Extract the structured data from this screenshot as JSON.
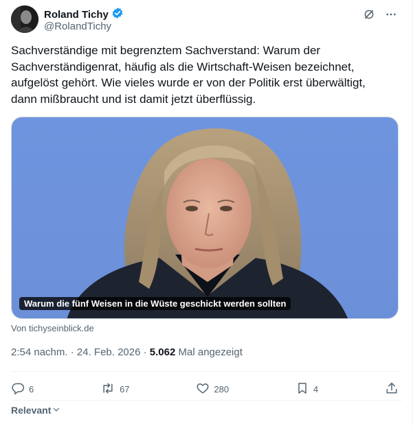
{
  "author": {
    "name": "Roland Tichy",
    "handle": "@RolandTichy",
    "verified": true
  },
  "tweet_text": "Sachverständige mit begrenztem Sachverstand: Warum der\nSachverständigenrat, häufig als die Wirtschaft-Weisen bezeichnet,\naufgelöst gehört. Wie vieles wurde er von der Politik erst überwältigt,\ndann mißbraucht und ist damit  jetzt überflüssig.",
  "link_card": {
    "caption": "Warum die fünf Weisen in die Wüste geschickt werden sollten",
    "source": "Von tichyseinblick.de"
  },
  "meta": {
    "time_date": "2:54 nachm. · 24. Feb. 2026 · ",
    "views_count": "5.062",
    "views_label": " Mal angezeigt"
  },
  "actions": {
    "replies": "6",
    "reposts": "67",
    "likes": "280",
    "bookmarks": "4"
  },
  "sort_label": "Relevant",
  "colors": {
    "verified": "#1d9bf0",
    "secondary_text": "#536471",
    "text": "#0f1419",
    "divider": "#eff3f4"
  },
  "icons": [
    "verified-badge-icon",
    "grok-icon",
    "more-icon",
    "reply-icon",
    "repost-icon",
    "like-icon",
    "bookmark-icon",
    "share-icon",
    "chevron-down-icon"
  ]
}
